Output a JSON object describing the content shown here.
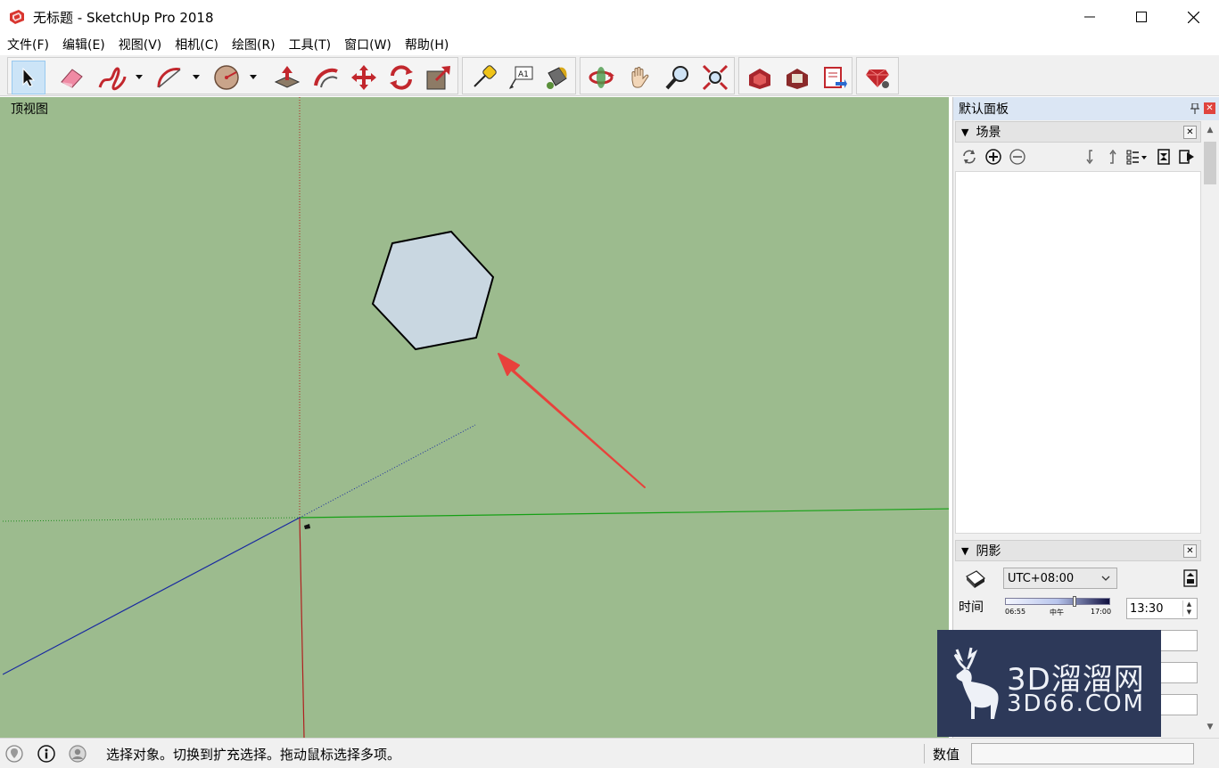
{
  "window": {
    "title": "无标题 - SketchUp Pro 2018",
    "icons": [
      "sketchup-logo-icon",
      "minimize-icon",
      "maximize-icon",
      "close-icon"
    ]
  },
  "menu": {
    "items": [
      "文件(F)",
      "编辑(E)",
      "视图(V)",
      "相机(C)",
      "绘图(R)",
      "工具(T)",
      "窗口(W)",
      "帮助(H)"
    ]
  },
  "toolbar": {
    "tools": [
      "select",
      "eraser",
      "freehand",
      "arc",
      "polygon",
      "push-pull",
      "follow-me",
      "move",
      "rotate",
      "scale",
      "tape-measure",
      "text",
      "paint-bucket",
      "orbit",
      "pan",
      "zoom",
      "zoom-extents",
      "warehouse",
      "extension-warehouse",
      "layout",
      "extension-manager"
    ],
    "active_tool": "select"
  },
  "viewport": {
    "view_name": "顶视图",
    "background_color": "#9cbb8e",
    "face_color": "#c9d7e1",
    "annotation_color": "#e8413b"
  },
  "tray": {
    "title": "默认面板",
    "scenes_panel": {
      "title": "场景"
    },
    "shadows_panel": {
      "title": "阴影",
      "timezone": "UTC+08:00",
      "time_label": "时间",
      "slider_start": "06:55",
      "slider_mid": "中午",
      "slider_end": "17:00",
      "time_value": "13:30",
      "time_fraction": 0.66
    }
  },
  "watermark": {
    "title": "3D溜溜网",
    "subtitle": "3D66.COM"
  },
  "statusbar": {
    "message": "选择对象。切换到扩充选择。拖动鼠标选择多项。",
    "vcb_label": "数值",
    "vcb_value": ""
  }
}
